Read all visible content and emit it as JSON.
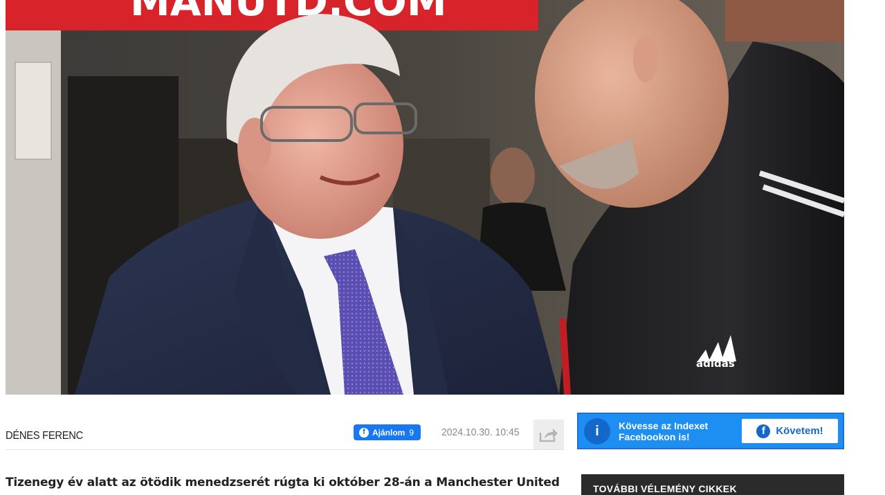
{
  "hero": {
    "banner_text": "MANUTD.COM",
    "badge_text": "adidas"
  },
  "article": {
    "author": "DÉNES FERENC",
    "like_label": "Ajánlom",
    "like_count": "9",
    "date": "2024.10.30. 10:45",
    "lead": "Tizenegy év alatt az ötödik menedzserét rúgta ki október 28-án a Manchester United"
  },
  "follow_box": {
    "text": "Kövesse az Indexet Facebookon is!",
    "button_label": "Követem!",
    "info_icon": "i",
    "fb_icon": "f"
  },
  "sidebar": {
    "heading": "TOVÁBBI VÉLEMÉNY CIKKEK"
  },
  "colors": {
    "facebook_blue": "#1877f2",
    "follow_bg": "#1d8ff2",
    "sidebar_dark": "#2b2b2b",
    "banner_red": "#d8232a"
  }
}
